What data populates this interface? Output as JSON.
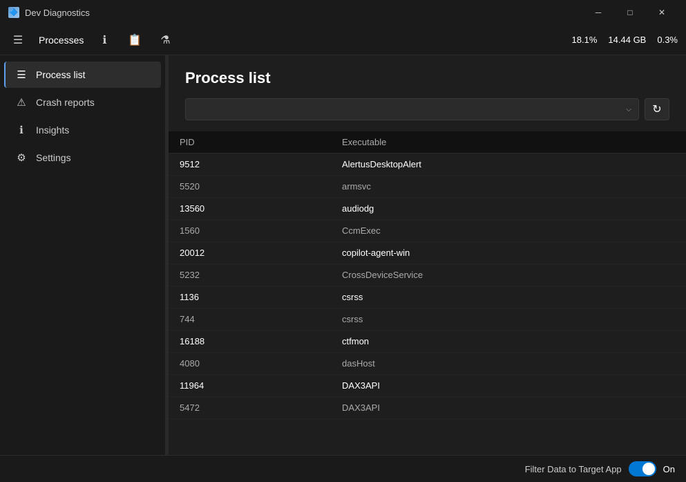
{
  "app": {
    "title": "Dev Diagnostics",
    "icon": "🔷"
  },
  "titlebar": {
    "minimize": "─",
    "maximize": "□",
    "close": "✕"
  },
  "toolbar": {
    "hamburger_icon": "☰",
    "processes_label": "Processes",
    "info_icon": "ℹ",
    "doc_icon": "📄",
    "settings_icon": "⚙",
    "cpu_stat": "18.1%",
    "mem_stat": "14.44 GB",
    "disk_stat": "0.3%"
  },
  "sidebar": {
    "items": [
      {
        "id": "process-list",
        "label": "Process list",
        "icon": "☰",
        "active": true
      },
      {
        "id": "crash-reports",
        "label": "Crash reports",
        "icon": "⚠",
        "active": false
      },
      {
        "id": "insights",
        "label": "Insights",
        "icon": "ℹ",
        "active": false
      },
      {
        "id": "settings",
        "label": "Settings",
        "icon": "⚙",
        "active": false
      }
    ]
  },
  "content": {
    "page_title": "Process list",
    "filter_placeholder": "",
    "filter_chevron": "⌵",
    "refresh_icon": "↻",
    "table": {
      "headers": [
        "PID",
        "Executable"
      ],
      "rows": [
        {
          "pid": "9512",
          "executable": "AlertusDesktopAlert",
          "bright": true
        },
        {
          "pid": "5520",
          "executable": "armsvc",
          "bright": false
        },
        {
          "pid": "13560",
          "executable": "audiodg",
          "bright": true
        },
        {
          "pid": "1560",
          "executable": "CcmExec",
          "bright": false
        },
        {
          "pid": "20012",
          "executable": "copilot-agent-win",
          "bright": true
        },
        {
          "pid": "5232",
          "executable": "CrossDeviceService",
          "bright": false
        },
        {
          "pid": "1136",
          "executable": "csrss",
          "bright": true
        },
        {
          "pid": "744",
          "executable": "csrss",
          "bright": false
        },
        {
          "pid": "16188",
          "executable": "ctfmon",
          "bright": true
        },
        {
          "pid": "4080",
          "executable": "dasHost",
          "bright": false
        },
        {
          "pid": "11964",
          "executable": "DAX3API",
          "bright": true
        },
        {
          "pid": "5472",
          "executable": "DAX3API",
          "bright": false
        }
      ]
    }
  },
  "footer": {
    "toggle_label": "Filter Data to Target App",
    "toggle_state": "On"
  }
}
